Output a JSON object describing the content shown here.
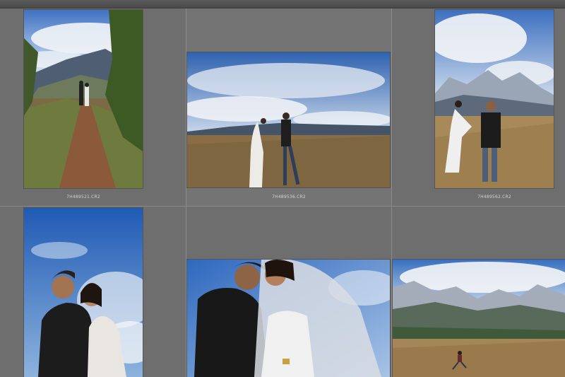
{
  "app": {
    "view": "grid"
  },
  "thumbnails": [
    {
      "filename": "7H489521.CR2",
      "scene": "couple-on-mountain-trail"
    },
    {
      "filename": "7H489536.CR2",
      "scene": "couple-walking-on-plateau"
    },
    {
      "filename": "7H489562.CR2",
      "scene": "couple-standing-snow-mountain"
    },
    {
      "filename": "",
      "scene": "couple-portrait-blue-sky"
    },
    {
      "filename": "",
      "scene": "couple-closeup-veil"
    },
    {
      "filename": "",
      "scene": "snow-mountain-landscape-runner"
    }
  ],
  "colors": {
    "background": "#6b6b6b",
    "cell": "#6e6e6e",
    "divider": "#8a8a8a",
    "filename_text": "#d4d4d4"
  }
}
